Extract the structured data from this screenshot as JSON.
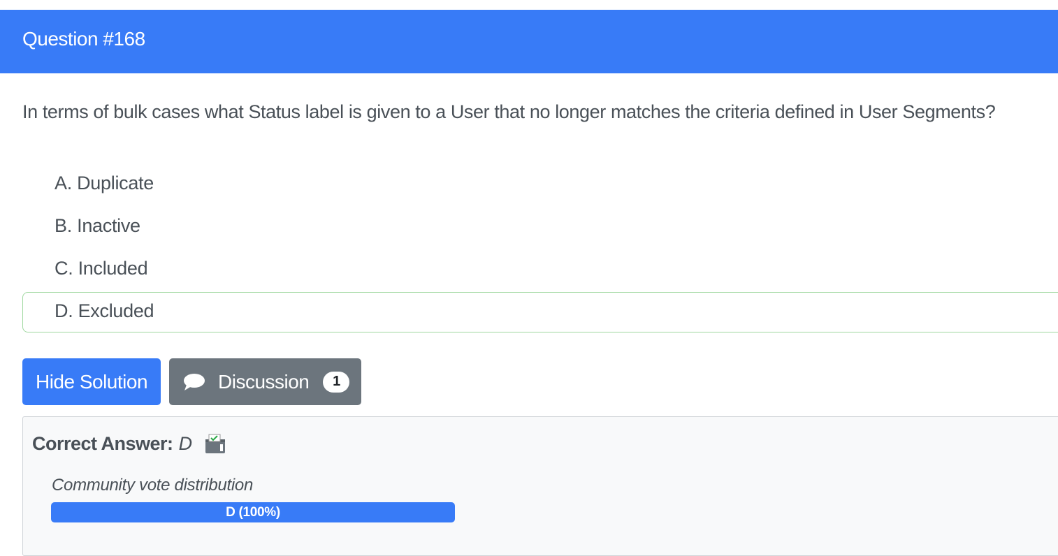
{
  "header": {
    "title": "Question #168"
  },
  "question": {
    "text": "In terms of bulk cases what Status label is given to a User that no longer matches the criteria defined in User Segments?"
  },
  "choices": [
    {
      "label": "A. Duplicate"
    },
    {
      "label": "B. Inactive"
    },
    {
      "label": "C. Included"
    },
    {
      "label": "D. Excluded",
      "correct": true
    }
  ],
  "buttons": {
    "solution_label": "Hide Solution",
    "discussion_label": "Discussion",
    "discussion_count": "1"
  },
  "answer": {
    "label": "Correct Answer:",
    "value": "D",
    "vote_title": "Community vote distribution",
    "vote_bar_label": "D (100%)",
    "vote_fraction": 1.0
  },
  "colors": {
    "primary": "#387bf7",
    "secondary": "#6c757d",
    "correct_border": "#9fd89f"
  },
  "icons": {
    "discussion": "chat-bubble-icon",
    "vote": "ballot-box-icon"
  }
}
